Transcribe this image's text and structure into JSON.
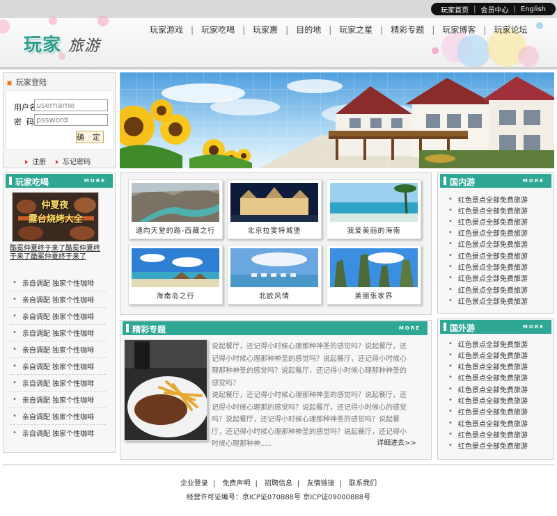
{
  "top_links": [
    "玩家首页",
    "会员中心",
    "English"
  ],
  "logo": {
    "main": "玩家",
    "sub": "旅游"
  },
  "nav": [
    "玩家游戏",
    "玩家吃喝",
    "玩家惠",
    "目的地",
    "玩家之星",
    "精彩专题",
    "玩家博客",
    "玩家论坛"
  ],
  "login": {
    "title": "玩家登陆",
    "username_label": "用户名",
    "username_value": "username",
    "password_label": "密  码",
    "password_value": "pssword",
    "submit": "确 定",
    "register": "注册",
    "forgot": "忘记密码"
  },
  "food": {
    "title": "玩家吃喝",
    "more": "MORE",
    "image_text": [
      "仲夏夜",
      "露台烧烤大全"
    ],
    "desc": "酷冕仲夏终于来了酷冕仲夏终于来了酷冕仲夏终于来了",
    "items": [
      "亲自调配 独家个性咖啡",
      "亲自调配 独家个性咖啡",
      "亲自调配 独家个性咖啡",
      "亲自调配 独家个性咖啡",
      "亲自调配 独家个性咖啡",
      "亲自调配 独家个性咖啡",
      "亲自调配 独家个性咖啡",
      "亲自调配 独家个性咖啡",
      "亲自调配 独家个性咖啡",
      "亲自调配 独家个性咖啡"
    ]
  },
  "photos": [
    {
      "caption": "通向天堂的路-西藏之行"
    },
    {
      "caption": "北京拉斐特城堡"
    },
    {
      "caption": "我爱美丽的海南"
    },
    {
      "caption": "海南岛之行"
    },
    {
      "caption": "北欧风情"
    },
    {
      "caption": "美丽张家界"
    }
  ],
  "feature": {
    "title": "精彩专题",
    "more": "MORE",
    "para1": "说起餐厅，还记得小时候心理那种神圣的感觉吗？说起餐厅，还记得小时候心理那种神圣的感觉吗？说起餐厅，还记得小时候心理那种神圣的感觉吗？说起餐厅，还记得小时候心理那种神圣的感觉吗？",
    "para2": "说起餐厅，还记得小时候心理那种神圣的感觉吗？说起餐厅，还记得小时候心理那的感觉吗？说起餐厅，还记得小时候心的感觉吗？说起餐厅，还记得小时候心理那种神圣的感觉吗？说起餐厅，还记得小时候心理那种神圣的感觉吗？说起餐厅，还记得小时候心理那种神.....",
    "detail": "详细进去>>"
  },
  "domestic": {
    "title": "国内游",
    "more": "MORE",
    "items": [
      "红色景点全部免费旅游",
      "红色景点全部免费旅游",
      "红色景点全部免费旅游",
      "红色景点全部免费旅游",
      "红色景点全部免费旅游",
      "红色景点全部免费旅游",
      "红色景点全部免费旅游",
      "红色景点全部免费旅游",
      "红色景点全部免费旅游",
      "红色景点全部免费旅游"
    ]
  },
  "abroad": {
    "title": "国外游",
    "more": "MORE",
    "items": [
      "红色景点全部免费旅游",
      "红色景点全部免费旅游",
      "红色景点全部免费旅游",
      "红色景点全部免费旅游",
      "红色景点全部免费旅游",
      "红色景点全部免费旅游",
      "红色景点全部免费旅游",
      "红色景点全部免费旅游",
      "红色景点全部免费旅游",
      "红色景点全部免费旅游"
    ]
  },
  "footer": {
    "links": [
      "企业登录",
      "免费声明",
      "招聘信息",
      "友情链接",
      "联系我们"
    ],
    "icp": "经营许可证编号：京ICP证070888号 京ICP证09000888号"
  },
  "colors": {
    "accent": "#2fa795",
    "border": "#cfcfcf"
  }
}
